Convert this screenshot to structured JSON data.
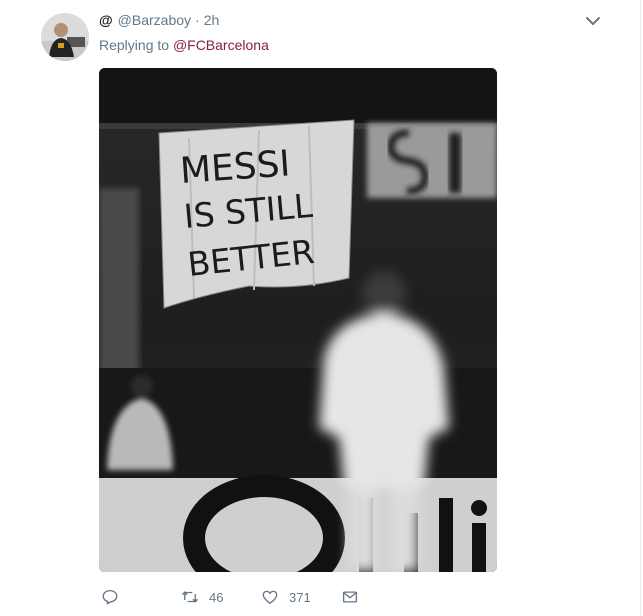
{
  "tweet": {
    "handle_glyph": "@",
    "handle": "@Barzaboy",
    "separator": "·",
    "time": "2h",
    "replying_prefix": "Replying to",
    "replying_to": "@FCBarcelona",
    "banner_text": [
      "MESSI",
      "IS STILL",
      "BETTER"
    ]
  },
  "actions": {
    "reply_icon": "reply-icon",
    "retweet_icon": "retweet-icon",
    "retweet_count": "46",
    "like_icon": "heart-icon",
    "like_count": "371",
    "message_icon": "envelope-icon"
  },
  "colors": {
    "link": "#8b1e3f",
    "muted": "#657786"
  }
}
